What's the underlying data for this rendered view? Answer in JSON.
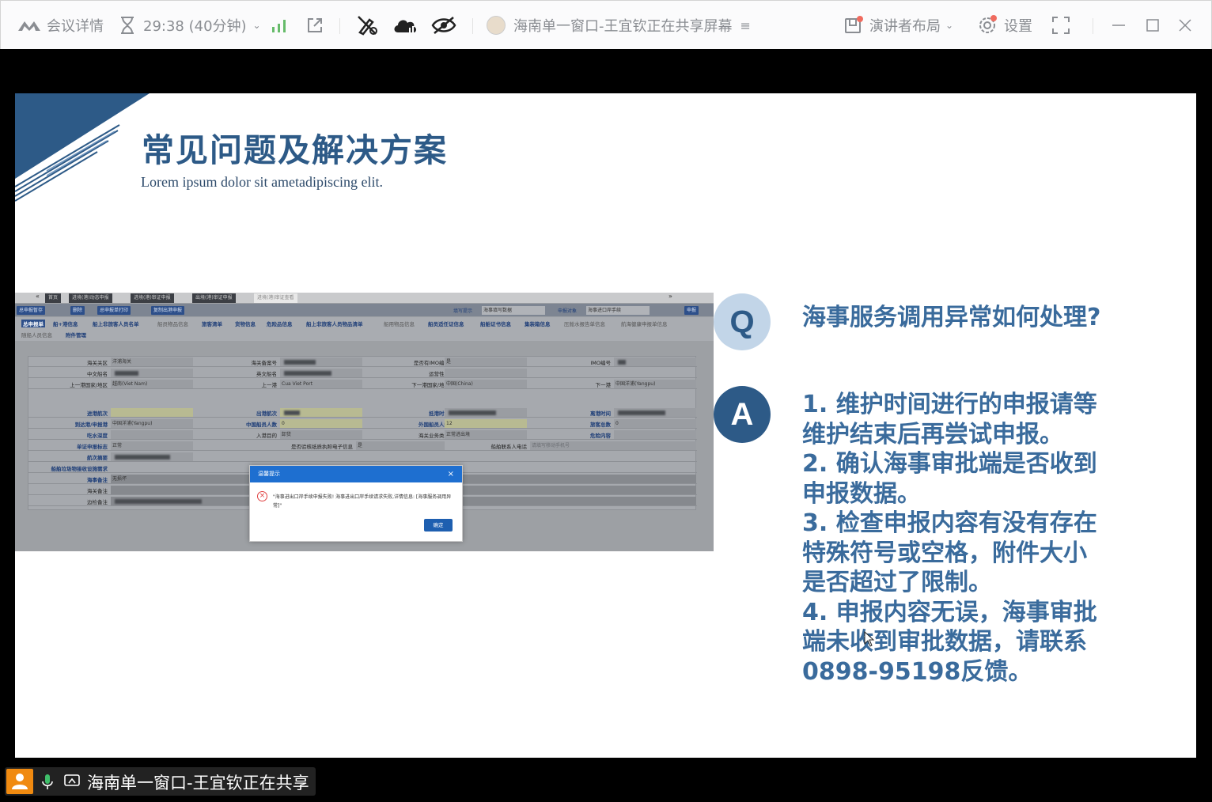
{
  "toolbar": {
    "meeting_details": "会议详情",
    "timer": "29:38 (40分钟)",
    "sharer": "海南单一窗口-王宜钦正在共享屏幕",
    "presenter_layout": "演讲者布局",
    "settings": "设置"
  },
  "slide": {
    "title": "常见问题及解决方案",
    "subtitle": "Lorem ipsum dolor sit ametadipiscing elit.",
    "q_badge": "Q",
    "a_badge": "A",
    "question": "海事服务调用异常如何处理?",
    "answer_lines": [
      "1. 维护时间进行的申报请等",
      "维护结束后再尝试申报。",
      "2. 确认海事审批端是否收到",
      "申报数据。",
      "3. 检查申报内容有没有存在",
      "特殊符号或空格，附件大小",
      "是否超过了限制。",
      "4. 申报内容无误，海事审批",
      "端未收到审批数据，请联系",
      "0898-95198反馈。"
    ]
  },
  "embedded_screenshot": {
    "tabs": [
      "首页",
      "进境(港)动态申报",
      "进境(港)审证申报",
      "出境(港)审证申报",
      "进境(港)审证查看"
    ],
    "buttons": [
      "总申报暂存",
      "删除",
      "总申报单打印",
      "复制出港申报"
    ],
    "fill_hint_label": "填写提示",
    "fill_hint_value": "海事填写数据",
    "report_target_label": "申报对象",
    "report_target_value": "海事进口岸手续",
    "report_button": "申报",
    "subtabs": [
      "总申报单",
      "船+港信息",
      "船上非旅客人员名单",
      "船员物品信息",
      "旅客清单",
      "货物信息",
      "危险品信息",
      "船上非旅客人员物品清单",
      "船用物品信息",
      "船员适任证信息",
      "船舶证书信息",
      "集装箱信息",
      "压舱水报告单信息",
      "航海健康申报单信息",
      "随船人员信息",
      "附件管理"
    ],
    "fields": {
      "customs_district_label": "海关关区",
      "customs_district_value": "洋浦海关",
      "customs_reg_label": "海关备案号",
      "has_imo_label": "是否有IMO编号",
      "has_imo_value": "是",
      "imo_label": "IMO编号",
      "cn_ship_name_label": "中文船名",
      "en_ship_name_label": "英文船名",
      "operator_label": "运营性质",
      "prev_country_label": "上一港国家/地区",
      "prev_country_value": "越南(Viet Nam)",
      "prev_port_label": "上一港",
      "prev_port_value": "Cua Viet Port",
      "next_country_label": "下一港国家/地区",
      "next_country_value": "中国(China)",
      "next_port_label": "下一港",
      "next_port_value": "中国洋浦(Yangpu)",
      "in_voyage_label": "进港航次",
      "out_voyage_label": "出港航次",
      "arrival_time_label": "抵港时间",
      "departure_time_label": "离港时间",
      "arrival_port_label": "到达港/申报港",
      "arrival_port_value": "中国洋浦(Yangpu)",
      "cn_crew_label": "中国船员人数",
      "cn_crew_value": "0",
      "foreign_crew_label": "外国船员人数",
      "foreign_crew_value": "12",
      "total_pax_label": "旅客总数",
      "total_pax_value": "0",
      "draft_label": "吃水深度",
      "purpose_label": "入港目的",
      "purpose_value": "卸货",
      "biz_type_label": "海关业务类型",
      "biz_type_value": "正常进出境",
      "danger_label": "危险内容",
      "mark_label": "单证申报标志",
      "mark_value": "正常",
      "health_label": "是否验核纸质执照电子信息",
      "health_value": "是",
      "contact_label": "船舶联系人电话",
      "contact_placeholder": "请填写移动手机号",
      "voyage_summary_label": "航次摘要",
      "waste_label": "船舶垃圾物接收设施需求",
      "maritime_note_label": "海事备注",
      "maritime_note_value": "无损坏",
      "customs_note_label": "海关备注",
      "border_note_label": "边检备注"
    },
    "dialog": {
      "title": "温馨提示",
      "message": "\"海事进出口岸手续申报失败! 海事进出口岸手续请求失败,详情信息: [海事服务调用异常]\"",
      "ok": "确定"
    }
  },
  "status_bar": {
    "sharer": "海南单一窗口-王宜钦正在共享"
  },
  "colors": {
    "slide_blue": "#2d5a87",
    "text_blue": "#3a6b9c",
    "dialog_blue": "#1e6fd0",
    "user_orange": "#f08a10"
  }
}
